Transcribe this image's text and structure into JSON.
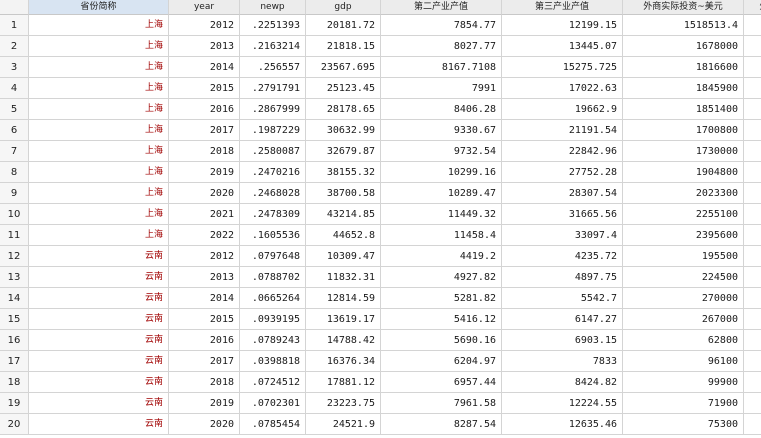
{
  "columns": [
    "省份简称",
    "year",
    "newp",
    "gdp",
    "第二产业产值",
    "第三产业产值",
    "外商实际投资~美元",
    "外"
  ],
  "rows": [
    {
      "n": "1",
      "prov": "上海",
      "year": "2012",
      "newp": ".2251393",
      "gdp": "20181.72",
      "sec": "7854.77",
      "ter": "12199.15",
      "fdi": "1518513.4"
    },
    {
      "n": "2",
      "prov": "上海",
      "year": "2013",
      "newp": ".2163214",
      "gdp": "21818.15",
      "sec": "8027.77",
      "ter": "13445.07",
      "fdi": "1678000"
    },
    {
      "n": "3",
      "prov": "上海",
      "year": "2014",
      "newp": ".256557",
      "gdp": "23567.695",
      "sec": "8167.7108",
      "ter": "15275.725",
      "fdi": "1816600"
    },
    {
      "n": "4",
      "prov": "上海",
      "year": "2015",
      "newp": ".2791791",
      "gdp": "25123.45",
      "sec": "7991",
      "ter": "17022.63",
      "fdi": "1845900"
    },
    {
      "n": "5",
      "prov": "上海",
      "year": "2016",
      "newp": ".2867999",
      "gdp": "28178.65",
      "sec": "8406.28",
      "ter": "19662.9",
      "fdi": "1851400"
    },
    {
      "n": "6",
      "prov": "上海",
      "year": "2017",
      "newp": ".1987229",
      "gdp": "30632.99",
      "sec": "9330.67",
      "ter": "21191.54",
      "fdi": "1700800"
    },
    {
      "n": "7",
      "prov": "上海",
      "year": "2018",
      "newp": ".2580087",
      "gdp": "32679.87",
      "sec": "9732.54",
      "ter": "22842.96",
      "fdi": "1730000"
    },
    {
      "n": "8",
      "prov": "上海",
      "year": "2019",
      "newp": ".2470216",
      "gdp": "38155.32",
      "sec": "10299.16",
      "ter": "27752.28",
      "fdi": "1904800"
    },
    {
      "n": "9",
      "prov": "上海",
      "year": "2020",
      "newp": ".2468028",
      "gdp": "38700.58",
      "sec": "10289.47",
      "ter": "28307.54",
      "fdi": "2023300"
    },
    {
      "n": "10",
      "prov": "上海",
      "year": "2021",
      "newp": ".2478309",
      "gdp": "43214.85",
      "sec": "11449.32",
      "ter": "31665.56",
      "fdi": "2255100"
    },
    {
      "n": "11",
      "prov": "上海",
      "year": "2022",
      "newp": ".1605536",
      "gdp": "44652.8",
      "sec": "11458.4",
      "ter": "33097.4",
      "fdi": "2395600"
    },
    {
      "n": "12",
      "prov": "云南",
      "year": "2012",
      "newp": ".0797648",
      "gdp": "10309.47",
      "sec": "4419.2",
      "ter": "4235.72",
      "fdi": "195500"
    },
    {
      "n": "13",
      "prov": "云南",
      "year": "2013",
      "newp": ".0788702",
      "gdp": "11832.31",
      "sec": "4927.82",
      "ter": "4897.75",
      "fdi": "224500"
    },
    {
      "n": "14",
      "prov": "云南",
      "year": "2014",
      "newp": ".0665264",
      "gdp": "12814.59",
      "sec": "5281.82",
      "ter": "5542.7",
      "fdi": "270000"
    },
    {
      "n": "15",
      "prov": "云南",
      "year": "2015",
      "newp": ".0939195",
      "gdp": "13619.17",
      "sec": "5416.12",
      "ter": "6147.27",
      "fdi": "267000"
    },
    {
      "n": "16",
      "prov": "云南",
      "year": "2016",
      "newp": ".0789243",
      "gdp": "14788.42",
      "sec": "5690.16",
      "ter": "6903.15",
      "fdi": "62800"
    },
    {
      "n": "17",
      "prov": "云南",
      "year": "2017",
      "newp": ".0398818",
      "gdp": "16376.34",
      "sec": "6204.97",
      "ter": "7833",
      "fdi": "96100"
    },
    {
      "n": "18",
      "prov": "云南",
      "year": "2018",
      "newp": ".0724512",
      "gdp": "17881.12",
      "sec": "6957.44",
      "ter": "8424.82",
      "fdi": "99900"
    },
    {
      "n": "19",
      "prov": "云南",
      "year": "2019",
      "newp": ".0702301",
      "gdp": "23223.75",
      "sec": "7961.58",
      "ter": "12224.55",
      "fdi": "71900"
    },
    {
      "n": "20",
      "prov": "云南",
      "year": "2020",
      "newp": ".0785454",
      "gdp": "24521.9",
      "sec": "8287.54",
      "ter": "12635.46",
      "fdi": "75300"
    }
  ],
  "colors": {
    "string_text": "#a00000",
    "header_bg": "#ececec",
    "grid_line": "#d4d4d4"
  }
}
